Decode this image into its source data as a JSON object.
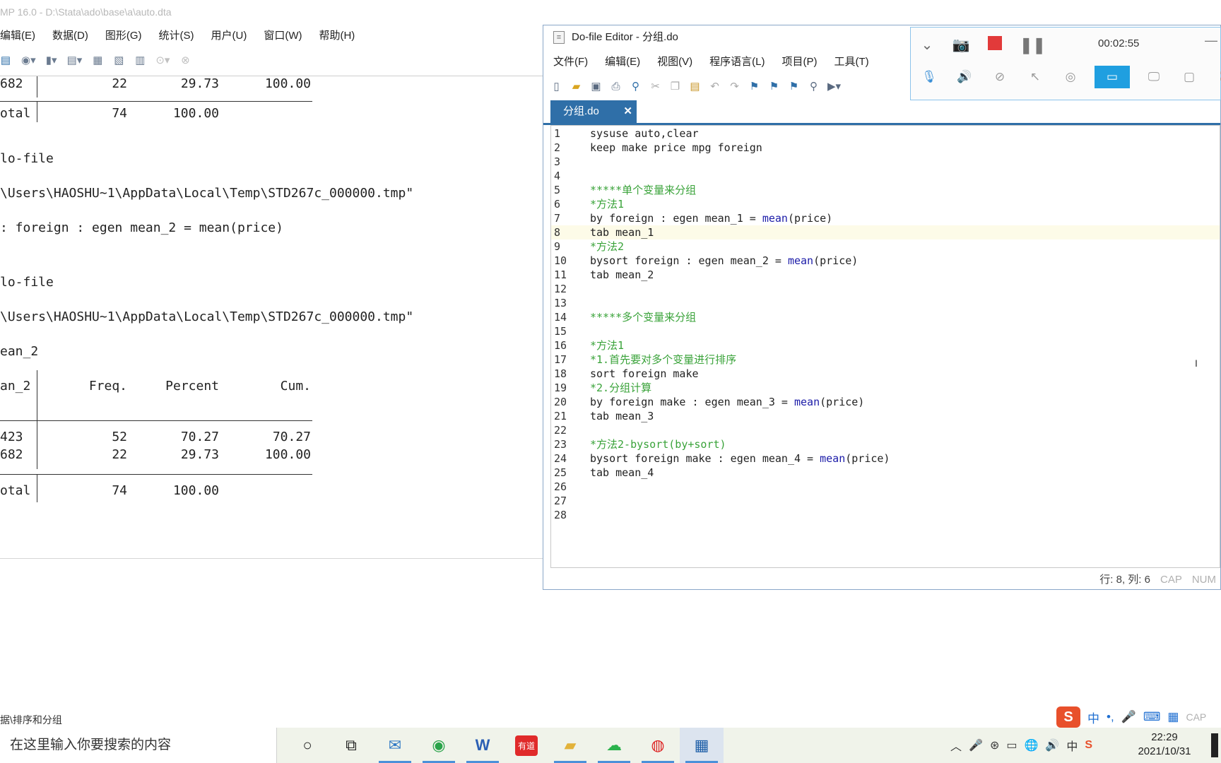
{
  "stata": {
    "title": "MP 16.0 - D:\\Stata\\ado\\base\\a\\auto.dta",
    "menu": [
      "编辑(E)",
      "数据(D)",
      "图形(G)",
      "统计(S)",
      "用户(U)",
      "窗口(W)",
      "帮助(H)"
    ],
    "status": "据\\排序和分组"
  },
  "results": {
    "row0": {
      "label": "682",
      "freq": "22",
      "pct": "29.73",
      "cum": "100.00"
    },
    "total0": {
      "label": "otal",
      "freq": "74",
      "pct": "100.00"
    },
    "line_dofile1": "lo-file",
    "line_path1": "\\Users\\HAOSHU~1\\AppData\\Local\\Temp\\STD267c_000000.tmp\"",
    "line_cmd": ": foreign : egen mean_2 = mean(price)",
    "line_dofile2": "lo-file",
    "line_path2": "\\Users\\HAOSHU~1\\AppData\\Local\\Temp\\STD267c_000000.tmp\"",
    "line_var": "ean_2",
    "header": {
      "label": "an_2",
      "freq": "Freq.",
      "pct": "Percent",
      "cum": "Cum."
    },
    "rows": [
      {
        "label": "423",
        "freq": "52",
        "pct": "70.27",
        "cum": "70.27"
      },
      {
        "label": "682",
        "freq": "22",
        "pct": "29.73",
        "cum": "100.00"
      }
    ],
    "total": {
      "label": "otal",
      "freq": "74",
      "pct": "100.00"
    }
  },
  "editor": {
    "title": "Do-file Editor - 分组.do",
    "menu": [
      "文件(F)",
      "编辑(E)",
      "视图(V)",
      "程序语言(L)",
      "项目(P)",
      "工具(T)"
    ],
    "tab": "分组.do",
    "tab_close": "✕",
    "lines": [
      {
        "n": "1",
        "t": "sysuse auto,clear"
      },
      {
        "n": "2",
        "t": "keep make price mpg foreign"
      },
      {
        "n": "3",
        "t": ""
      },
      {
        "n": "4",
        "t": ""
      },
      {
        "n": "5",
        "t": "*****单个变量来分组"
      },
      {
        "n": "6",
        "t": "*方法1"
      },
      {
        "n": "7",
        "t": "by foreign : egen mean_1 = ",
        "fn": "mean",
        "after": "(price)"
      },
      {
        "n": "8",
        "t": "tab mean_1"
      },
      {
        "n": "9",
        "t": "*方法2"
      },
      {
        "n": "10",
        "t": "bysort foreign : egen mean_2 = ",
        "fn": "mean",
        "after": "(price)"
      },
      {
        "n": "11",
        "t": "tab mean_2"
      },
      {
        "n": "12",
        "t": ""
      },
      {
        "n": "13",
        "t": ""
      },
      {
        "n": "14",
        "t": "*****多个变量来分组"
      },
      {
        "n": "15",
        "t": ""
      },
      {
        "n": "16",
        "t": "*方法1"
      },
      {
        "n": "17",
        "t": "*1.首先要对多个变量进行排序"
      },
      {
        "n": "18",
        "t": "sort foreign make"
      },
      {
        "n": "19",
        "t": "*2.分组计算"
      },
      {
        "n": "20",
        "t": "by foreign make : egen mean_3 = ",
        "fn": "mean",
        "after": "(price)"
      },
      {
        "n": "21",
        "t": "tab mean_3"
      },
      {
        "n": "22",
        "t": ""
      },
      {
        "n": "23",
        "t": "*方法2-bysort(by+sort)"
      },
      {
        "n": "24",
        "t": "bysort foreign make : egen mean_4 = ",
        "fn": "mean",
        "after": "(price)"
      },
      {
        "n": "25",
        "t": "tab mean_4"
      },
      {
        "n": "26",
        "t": ""
      },
      {
        "n": "27",
        "t": ""
      },
      {
        "n": "28",
        "t": ""
      }
    ],
    "status_pos": "行: 8, 列: 6",
    "status_cap": "CAP",
    "status_num": "NUM"
  },
  "recorder": {
    "time": "00:02:55"
  },
  "ime": {
    "zh": "中",
    "punct": "•,",
    "cap": "CAP"
  },
  "taskbar": {
    "search_placeholder": "在这里输入你要搜索的内容",
    "time": "22:29",
    "date": "2021/10/31",
    "youdao": "有道",
    "lang": "中"
  },
  "colors": {
    "accent": "#2f6fa8",
    "comment": "#3aa33a",
    "function": "#1b1ba8",
    "record_stop": "#e23a3a",
    "recorder_selected": "#1f9fe0"
  }
}
